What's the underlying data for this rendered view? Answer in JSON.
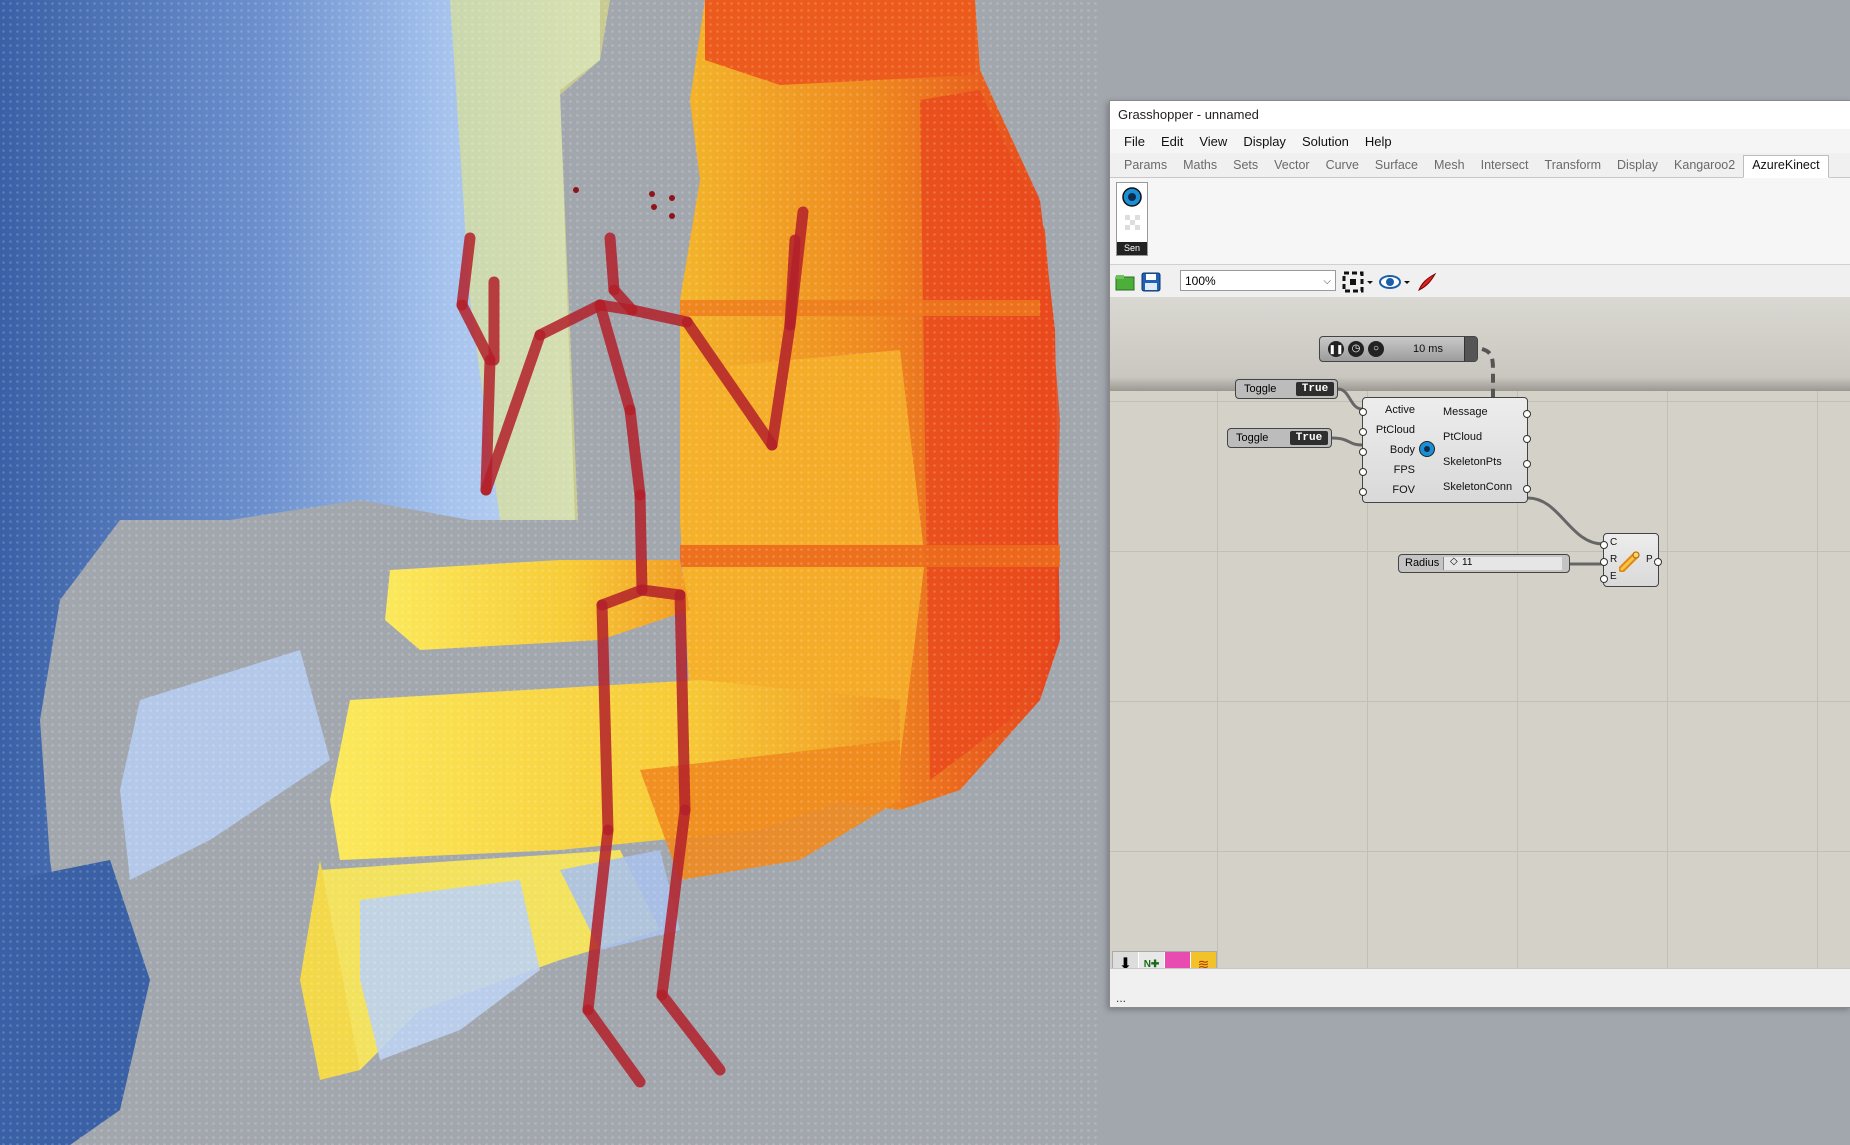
{
  "window": {
    "title": "Grasshopper - unnamed",
    "menu": [
      "File",
      "Edit",
      "View",
      "Display",
      "Solution",
      "Help"
    ],
    "tabs": [
      "Params",
      "Maths",
      "Sets",
      "Vector",
      "Curve",
      "Surface",
      "Mesh",
      "Intersect",
      "Transform",
      "Display",
      "Kangaroo2",
      "AzureKinect"
    ],
    "active_tab": "AzureKinect",
    "ribbon_icon_label": "Sen",
    "zoom": "100%",
    "status": "..."
  },
  "canvas": {
    "timer": {
      "label": "10 ms"
    },
    "toggle1": {
      "label": "Toggle",
      "value": "True"
    },
    "toggle2": {
      "label": "Toggle",
      "value": "True"
    },
    "kinect": {
      "inputs": [
        "Active",
        "PtCloud",
        "Body",
        "FPS",
        "FOV"
      ],
      "outputs": [
        "Message",
        "PtCloud",
        "SkeletonPts",
        "SkeletonConn"
      ]
    },
    "slider": {
      "label": "Radius",
      "value": "11"
    },
    "pipe": {
      "inputs": [
        "C",
        "R",
        "E"
      ],
      "output": "P"
    }
  },
  "colors": {
    "far": "#3b63a8",
    "mid": "#a8c6f0",
    "near_yellow": "#f7e04a",
    "orange": "#f08a1e",
    "red": "#e8341c",
    "skeleton": "#b3202a",
    "background": "#a2a7ae"
  }
}
